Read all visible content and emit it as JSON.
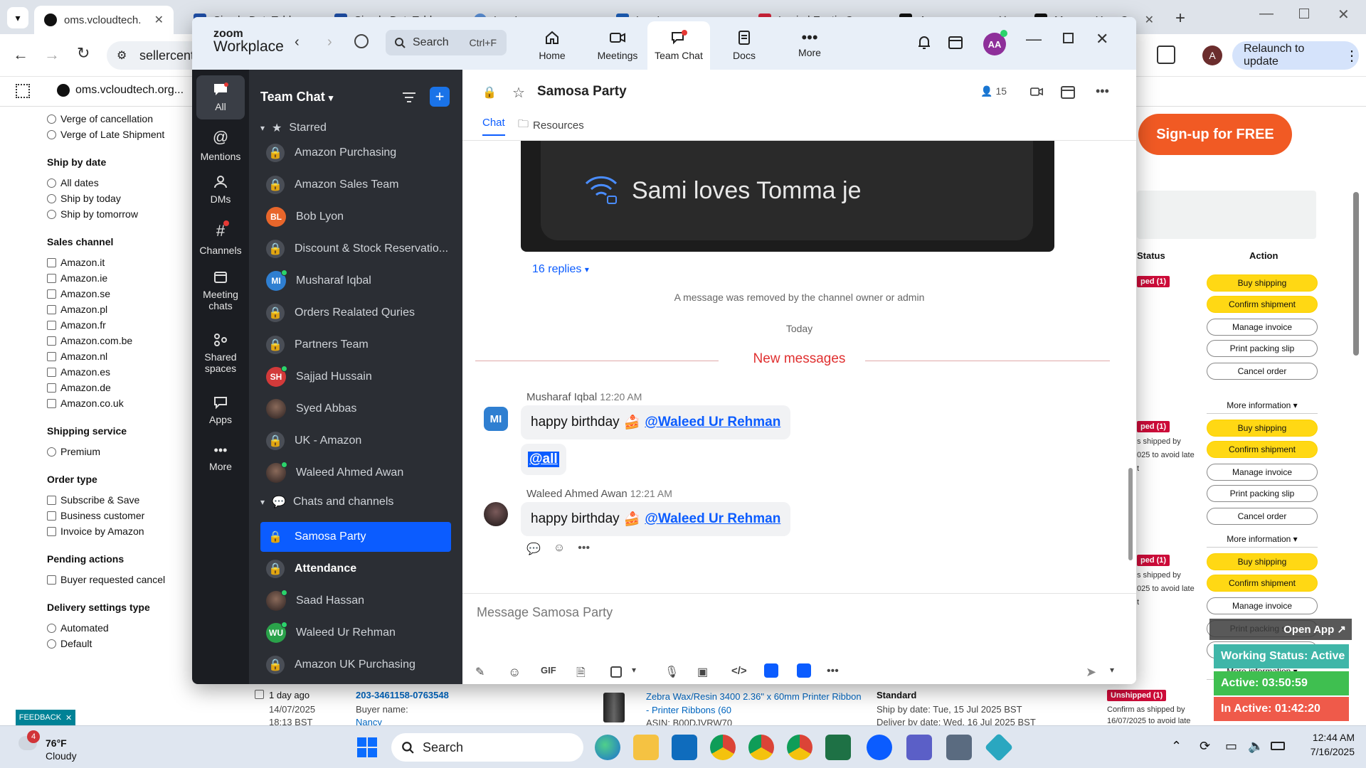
{
  "browser": {
    "tabs": [
      {
        "title": "oms.vcloudtech.",
        "active": false
      },
      {
        "title": "Simple DataTabl",
        "active": false
      },
      {
        "title": "Simple DataTabl",
        "active": false
      },
      {
        "title": "Log In",
        "active": false
      },
      {
        "title": "Log In",
        "active": false
      },
      {
        "title": "Login | Exotic C",
        "active": false
      },
      {
        "title": "Amazon",
        "active": true
      },
      {
        "title": "Manage Your O",
        "active": false
      }
    ],
    "url": "sellercent",
    "bookmark": "oms.vcloudtech.org...",
    "relaunch_label": "Relaunch to update",
    "profile_initial": "A"
  },
  "seller": {
    "filter_options_top": [
      "Verge of cancellation",
      "Verge of Late Shipment"
    ],
    "ship_by_date": {
      "heading": "Ship by date",
      "options": [
        "All dates",
        "Ship by today",
        "Ship by tomorrow"
      ]
    },
    "sales_channel": {
      "heading": "Sales channel",
      "options": [
        "Amazon.it",
        "Amazon.ie",
        "Amazon.se",
        "Amazon.pl",
        "Amazon.fr",
        "Amazon.com.be",
        "Amazon.nl",
        "Amazon.es",
        "Amazon.de",
        "Amazon.co.uk"
      ]
    },
    "shipping_service": {
      "heading": "Shipping service",
      "options": [
        "Premium"
      ]
    },
    "order_type": {
      "heading": "Order type",
      "options": [
        "Subscribe & Save",
        "Business customer",
        "Invoice by Amazon"
      ]
    },
    "pending_actions": {
      "heading": "Pending actions",
      "options": [
        "Buyer requested cancel"
      ]
    },
    "delivery_settings": {
      "heading": "Delivery settings type",
      "options": [
        "Automated",
        "Default"
      ]
    },
    "signup_label": "Sign-up for FREE",
    "col_status": "Status",
    "col_action": "Action",
    "unshipped_badge": "ped (1)",
    "unshipped_badge_full": "Unshipped (1)",
    "actions": {
      "buy_shipping": "Buy shipping",
      "confirm_shipment": "Confirm shipment",
      "manage_invoice": "Manage invoice",
      "print_packing_slip": "Print packing slip",
      "cancel_order": "Cancel order",
      "more_information": "More information ▾"
    },
    "ship_note_1": "s shipped by",
    "ship_note_2": "025 to avoid late",
    "ship_note_3": "t",
    "bottom_row": {
      "age": "1 day ago",
      "date": "14/07/2025",
      "time": "18:13 BST",
      "order_id": "203-3461158-0763548",
      "buyer_label": "Buyer name:",
      "buyer_name": "Nancy",
      "product": "Zebra Wax/Resin 3400 2.36\" x 60mm Printer Ribbon - Printer Ribbons (60",
      "asin": "ASIN: B00DJVRW70",
      "service": "Standard",
      "ship_by": "Ship by date: Tue, 15 Jul 2025 BST",
      "deliver_by": "Deliver by date: Wed, 16 Jul 2025 BST",
      "status": "Unshipped (1)",
      "confirm_note": "Confirm as shipped by",
      "confirm_note_2": "16/07/2025 to avoid late"
    },
    "feedback_label": "FEEDBACK"
  },
  "overlay": {
    "open_app": "Open App ↗",
    "working_status": "Working Status: Active",
    "active_time": "Active: 03:50:59",
    "inactive_time": "In Active: 01:42:20",
    "colors": {
      "working": "#3fb6a8",
      "active": "#3fbf50",
      "inactive": "#ef5a4a"
    }
  },
  "zoom": {
    "logo_top": "zoom",
    "logo_bottom": "Workplace",
    "search_placeholder": "Search",
    "search_shortcut": "Ctrl+F",
    "tabs": [
      {
        "label": "Home",
        "icon": "home-icon"
      },
      {
        "label": "Meetings",
        "icon": "video-icon"
      },
      {
        "label": "Team Chat",
        "icon": "chat-icon",
        "active": true
      },
      {
        "label": "Docs",
        "icon": "docs-icon"
      },
      {
        "label": "More",
        "icon": "more-icon"
      }
    ],
    "avatar_initials": "AA",
    "rail": [
      {
        "label": "All",
        "active": true
      },
      {
        "label": "Mentions"
      },
      {
        "label": "DMs"
      },
      {
        "label": "Channels"
      },
      {
        "label": "Meeting chats"
      },
      {
        "label": "Shared spaces"
      },
      {
        "label": "Apps"
      },
      {
        "label": "More"
      }
    ],
    "sidebar": {
      "title": "Team Chat",
      "starred_label": "Starred",
      "starred": [
        {
          "name": "Amazon Purchasing",
          "type": "channel"
        },
        {
          "name": "Amazon Sales Team",
          "type": "channel"
        },
        {
          "name": "Bob Lyon",
          "type": "initials",
          "initials": "BL",
          "color": "#e8662b"
        },
        {
          "name": "Discount & Stock Reservatio...",
          "type": "channel"
        },
        {
          "name": "Musharaf Iqbal",
          "type": "initials",
          "initials": "MI",
          "color": "#2f7fd1"
        },
        {
          "name": "Orders Realated Quries",
          "type": "channel"
        },
        {
          "name": "Partners Team",
          "type": "channel"
        },
        {
          "name": "Sajjad Hussain",
          "type": "initials",
          "initials": "SH",
          "color": "#d23a3a"
        },
        {
          "name": "Syed Abbas",
          "type": "photo"
        },
        {
          "name": "UK - Amazon",
          "type": "channel"
        },
        {
          "name": "Waleed Ahmed Awan",
          "type": "photo"
        }
      ],
      "chats_label": "Chats and channels",
      "chats": [
        {
          "name": "Samosa Party",
          "type": "channel",
          "selected": true
        },
        {
          "name": "Attendance",
          "type": "channel",
          "bold": true
        },
        {
          "name": "Saad Hassan",
          "type": "photo"
        },
        {
          "name": "Waleed Ur Rehman",
          "type": "initials",
          "initials": "WU",
          "color": "#2aa24a"
        },
        {
          "name": "Amazon UK Purchasing",
          "type": "channel"
        }
      ]
    },
    "channel": {
      "name": "Samosa Party",
      "member_count": "15",
      "tab_chat": "Chat",
      "tab_resources": "Resources",
      "image_text": "Sami loves Tomma je",
      "replies": "16 replies",
      "removed_msg": "A message was removed by the channel owner or admin",
      "today": "Today",
      "new_messages": "New messages",
      "messages": [
        {
          "sender": "Musharaf Iqbal",
          "time": "12:20 AM",
          "initials": "MI",
          "text": "happy birthday",
          "emoji": "🍰",
          "mention": "@Waleed Ur Rehman",
          "extra": "@all"
        },
        {
          "sender": "Waleed Ahmed Awan",
          "time": "12:21 AM",
          "text": "happy birthday",
          "emoji": "🍰",
          "mention": "@Waleed Ur Rehman"
        }
      ],
      "composer_placeholder": "Message Samosa Party",
      "gif_label": "GIF"
    }
  },
  "taskbar": {
    "weather_temp": "76°F",
    "weather_desc": "Cloudy",
    "weather_badge": "4",
    "search_label": "Search",
    "time": "12:44 AM",
    "date": "7/16/2025"
  }
}
